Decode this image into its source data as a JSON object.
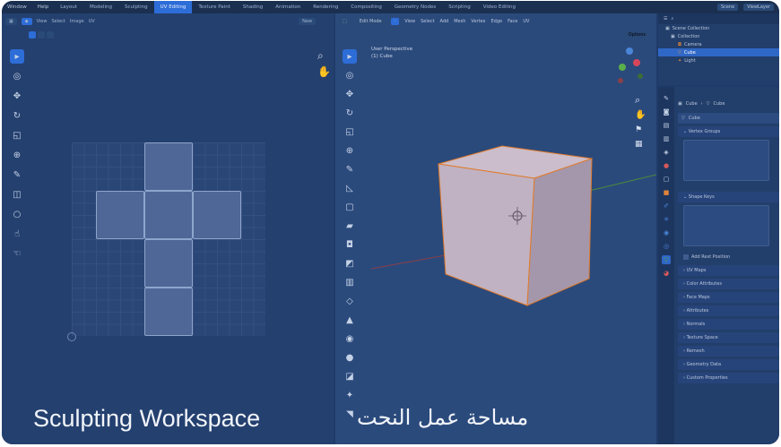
{
  "menu": {
    "items": [
      "Window",
      "Help"
    ],
    "tabs": [
      "Layout",
      "Modeling",
      "Sculpting",
      "UV Editing",
      "Texture Paint",
      "Shading",
      "Animation",
      "Rendering",
      "Compositing",
      "Geometry Nodes",
      "Scripting",
      "Video Editing"
    ],
    "active_tab": "UV Editing",
    "scene": "Scene",
    "view_layer": "ViewLayer"
  },
  "uv_editor": {
    "header": [
      "View",
      "Select",
      "Image",
      "UV"
    ],
    "new_button": "New"
  },
  "viewport": {
    "mode": "Edit Mode",
    "header": [
      "View",
      "Select",
      "Add",
      "Mesh",
      "Vertex",
      "Edge",
      "Face",
      "UV"
    ],
    "options": "Options",
    "info_line1": "User Perspective",
    "info_line2": "(1) Cube"
  },
  "outliner": {
    "title": "Scene Collection",
    "rows": [
      "Collection",
      "Camera",
      "Cube",
      "Light"
    ],
    "selected": "Cube"
  },
  "properties": {
    "breadcrumb": [
      "Cube",
      "Cube"
    ],
    "mesh_name": "Cube",
    "panels": [
      "Vertex Groups",
      "Shape Keys",
      "UV Maps",
      "Color Attributes",
      "Face Maps",
      "Attributes",
      "Normals",
      "Texture Space",
      "Remesh",
      "Geometry Data",
      "Custom Properties"
    ],
    "add_rest": "Add Rest Position"
  },
  "captions": {
    "english": "Sculpting Workspace",
    "arabic": "مساحة عمل النحت"
  },
  "colors": {
    "accent": "#2d6dd8",
    "cube_face": "#c9bcc9",
    "edge_orange": "#e07a2a"
  }
}
